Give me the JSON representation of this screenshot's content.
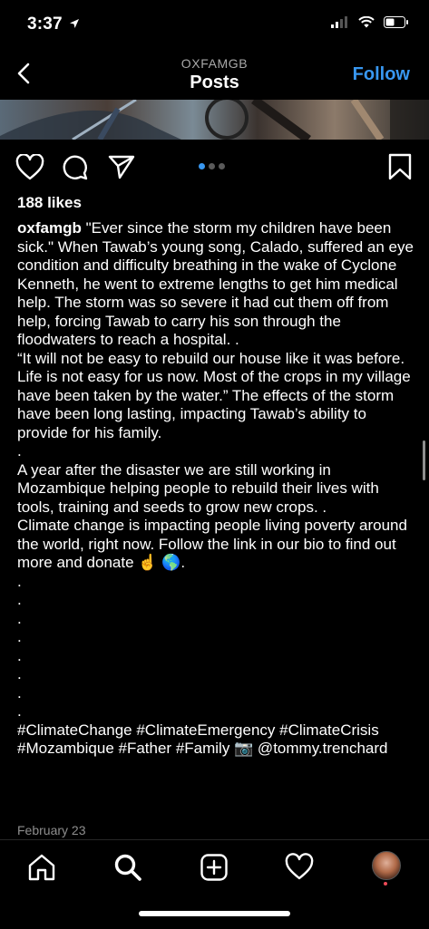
{
  "status_bar": {
    "time": "3:37"
  },
  "nav": {
    "account": "OXFAMGB",
    "title": "Posts",
    "follow_label": "Follow"
  },
  "post": {
    "likes": "188 likes",
    "username": "oxfamgb",
    "caption_first": "\"Ever since the storm my children have been sick.\" When Tawab’s young song, Calado, suffered an eye condition and difficulty breathing in the wake of Cyclone Kenneth, he went to extreme lengths to get him medical help. The storm was so severe it had cut them off from help, forcing Tawab to carry his son through the floodwaters to reach a hospital. .",
    "para2": "“It will not be easy to rebuild our house like it was before. Life is not easy for us now. Most of the crops in my village have been taken by the water.” The effects of the storm have been long lasting, impacting Tawab’s ability to provide for his family.",
    "dot": ".",
    "para3": "A year after the disaster we are still working in Mozambique helping people to rebuild their lives with tools, training and seeds to grow new crops. .",
    "para4": "Climate change is impacting people living poverty around the world, right now. Follow the link in our bio to find out more and donate ☝️ 🌎.",
    "hashtags": "#ClimateChange #ClimateEmergency #ClimateCrisis #Mozambique #Father #Family 📷 @tommy.trenchard",
    "date": "February 23"
  },
  "colors": {
    "accent": "#3897f0",
    "background": "#000000",
    "muted": "#8e8e8e"
  },
  "icons": {
    "nav": "back-chevron-icon",
    "actions": [
      "heart-icon",
      "comment-icon",
      "share-icon",
      "bookmark-icon"
    ],
    "tabbar": [
      "home-icon",
      "search-icon",
      "new-post-icon",
      "activity-heart-icon",
      "profile-avatar"
    ]
  }
}
